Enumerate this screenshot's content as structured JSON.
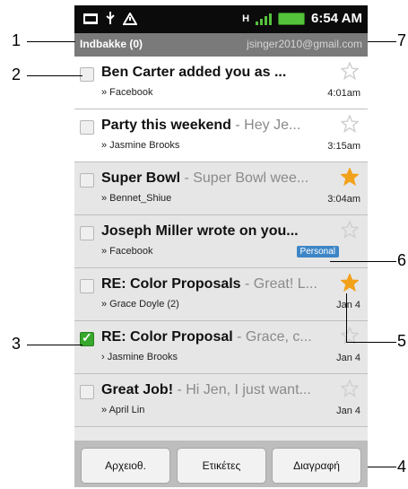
{
  "status": {
    "time": "6:54 AM",
    "network": "H"
  },
  "header": {
    "title": "Indbakke (0)",
    "account": "jsinger2010@gmail.com"
  },
  "messages": [
    {
      "subject": "Ben Carter added you as ...",
      "snippet": "",
      "sender": "» Facebook",
      "time": "4:01am",
      "unread": true,
      "checked": false,
      "starred": false,
      "label": ""
    },
    {
      "subject": "Party this weekend",
      "snippet": " - Hey Je...",
      "sender": "» Jasmine Brooks",
      "time": "3:15am",
      "unread": true,
      "checked": false,
      "starred": false,
      "label": ""
    },
    {
      "subject": "Super Bowl",
      "snippet": " - Super Bowl wee...",
      "sender": "» Bennet_Shiue",
      "time": "3:04am",
      "unread": false,
      "checked": false,
      "starred": true,
      "label": ""
    },
    {
      "subject": "Joseph Miller wrote on you...",
      "snippet": "",
      "sender": "» Facebook",
      "time": "",
      "unread": false,
      "checked": false,
      "starred": false,
      "label": "Personal"
    },
    {
      "subject": "RE: Color Proposals",
      "snippet": " - Great! L...",
      "sender": "» Grace Doyle (2)",
      "time": "Jan 4",
      "unread": false,
      "checked": false,
      "starred": true,
      "label": ""
    },
    {
      "subject": "RE: Color Proposal",
      "snippet": " - Grace, c...",
      "sender": "› Jasmine Brooks",
      "time": "Jan 4",
      "unread": false,
      "checked": true,
      "starred": false,
      "label": ""
    },
    {
      "subject": "Great Job!",
      "snippet": " - Hi Jen, I just want...",
      "sender": "» April Lin",
      "time": "Jan 4",
      "unread": false,
      "checked": false,
      "starred": false,
      "label": ""
    }
  ],
  "buttons": {
    "archive": "Αρχειοθ.",
    "labels": "Ετικέτες",
    "delete": "Διαγραφή"
  },
  "annotations": [
    "1",
    "2",
    "3",
    "4",
    "5",
    "6",
    "7"
  ],
  "colors": {
    "star_on": "#f2a11a",
    "star_off": "#d0d0d0",
    "label_bg": "#3d86c6",
    "check": "#36a82b"
  }
}
